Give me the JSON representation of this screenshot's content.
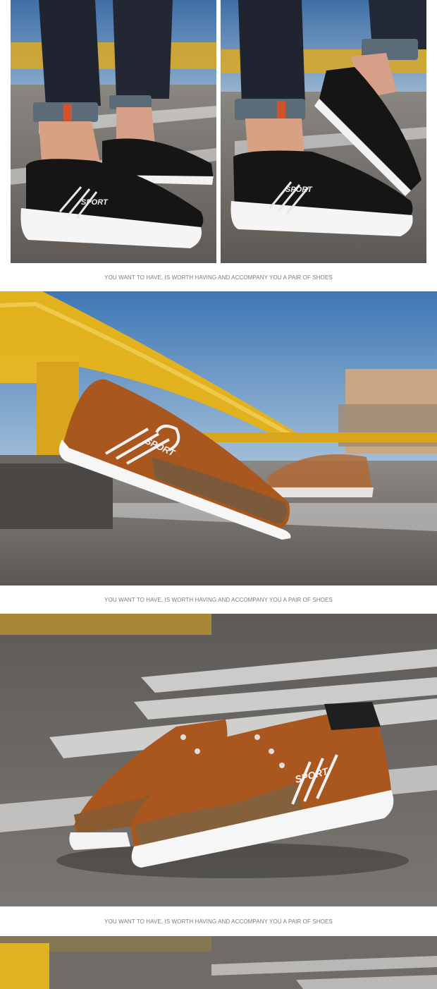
{
  "captions": [
    "YOU WANT TO HAVE, IS WORTH HAVING AND ACCOMPANY YOU A PAIR OF SHOES",
    "YOU WANT TO HAVE, IS WORTH HAVING AND ACCOMPANY YOU A PAIR OF SHOES",
    "YOU WANT TO HAVE, IS WORTH HAVING AND ACCOMPANY YOU A PAIR OF SHOES"
  ],
  "brand_mark": "SPORT",
  "colors": {
    "black_shoe": "#151515",
    "brown_shoe": "#a9561f",
    "sole": "#f4f4f4",
    "sky": "#4f7fb0",
    "pipe_yellow": "#e3b21f",
    "pavement": "#6f6a66"
  }
}
